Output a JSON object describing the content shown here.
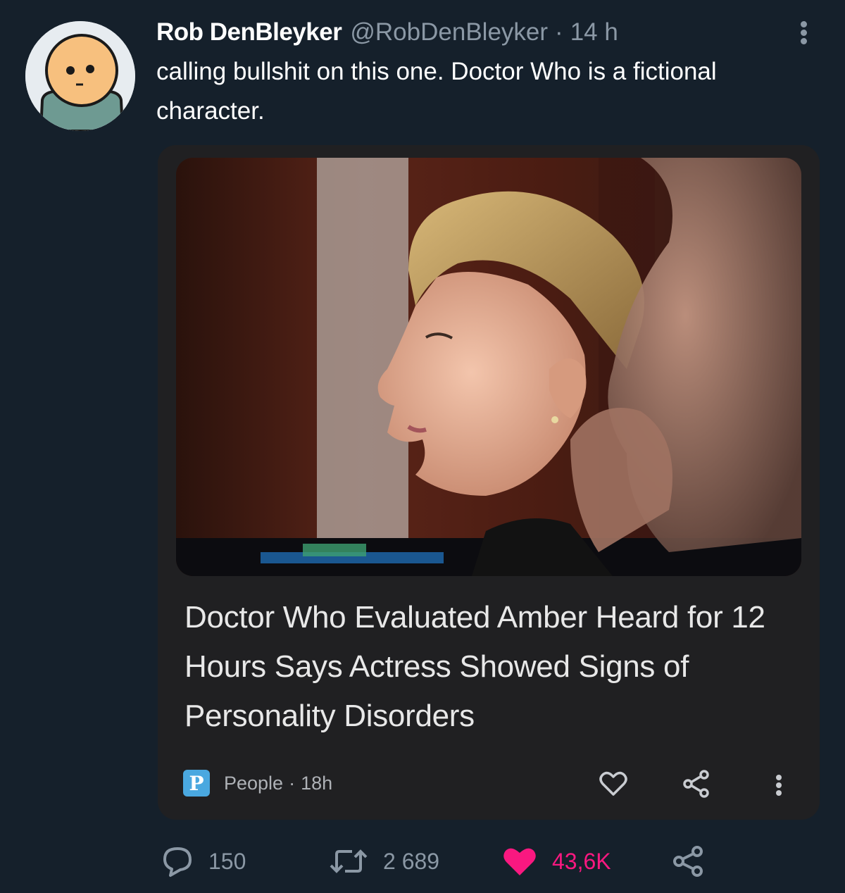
{
  "tweet": {
    "author_name": "Rob DenBleyker",
    "author_handle": "@RobDenBleyker",
    "separator": "·",
    "time": "14 h",
    "text": "calling bullshit on this one. Doctor Who is a fictional character.",
    "more_icon": "more-vertical-icon"
  },
  "card": {
    "headline": "Doctor Who Evaluated Amber Heard for 12 Hours Says Actress Showed Signs of Personality Disorders",
    "source_logo": "P",
    "source_name": "People",
    "separator": "·",
    "age": "18h",
    "icons": [
      "heart-outline-icon",
      "share-icon",
      "more-vertical-icon"
    ]
  },
  "actions": {
    "replies": "150",
    "retweets": "2 689",
    "likes": "43,6K",
    "icons": [
      "reply-icon",
      "retweet-icon",
      "heart-filled-icon",
      "share-icon"
    ]
  },
  "colors": {
    "background": "#15202b",
    "card_background": "#202022",
    "secondary_text": "#8b98a5",
    "like_pink": "#f91880",
    "source_logo_blue": "#4aa8e0"
  }
}
